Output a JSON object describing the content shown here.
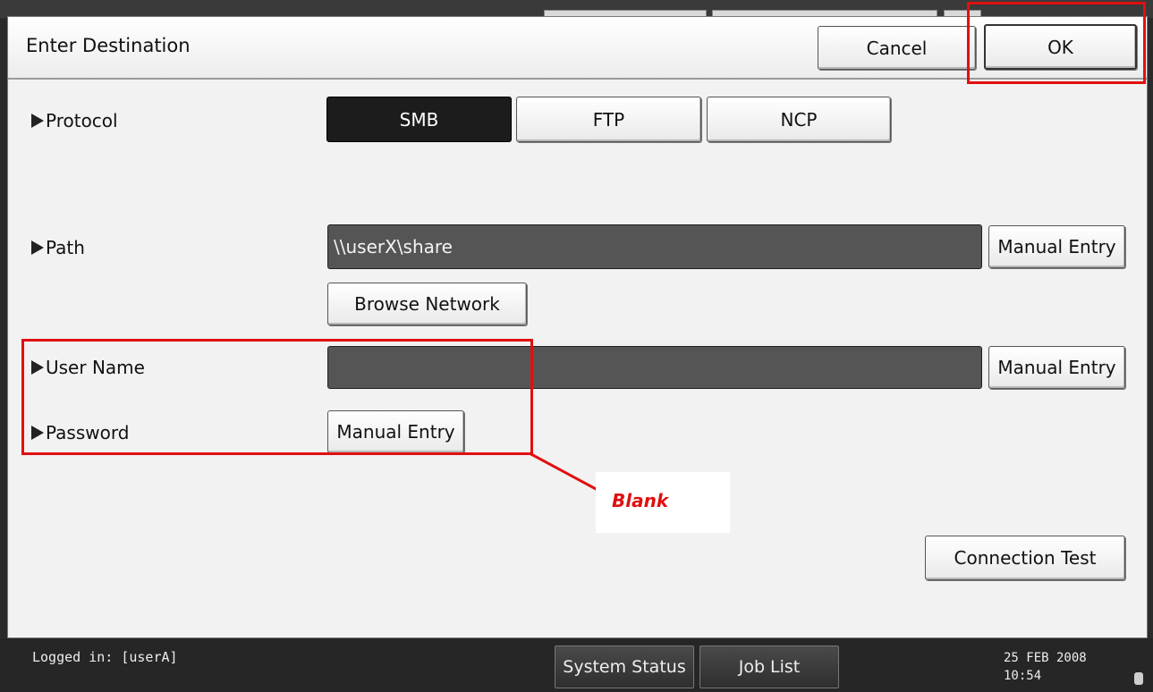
{
  "title": "Enter Destination",
  "buttons": {
    "cancel": "Cancel",
    "ok": "OK"
  },
  "protocol": {
    "label": "Protocol",
    "options": [
      "SMB",
      "FTP",
      "NCP"
    ],
    "selected": "SMB"
  },
  "path": {
    "label": "Path",
    "value": "\\\\userX\\share",
    "manual_entry": "Manual Entry",
    "browse": "Browse Network"
  },
  "user_name": {
    "label": "User Name",
    "value": "",
    "manual_entry": "Manual Entry"
  },
  "password": {
    "label": "Password",
    "manual_entry": "Manual Entry"
  },
  "annotation": {
    "text": "Blank",
    "color": "#e01010"
  },
  "connection_test": "Connection Test",
  "status": {
    "logged_in": "Logged in: [userA]",
    "system_status": "System Status",
    "job_list": "Job List",
    "date": "25 FEB  2008",
    "time": "10:54"
  },
  "icons": {
    "row_marker": "right-triangle-icon",
    "device": "toner-icon"
  }
}
